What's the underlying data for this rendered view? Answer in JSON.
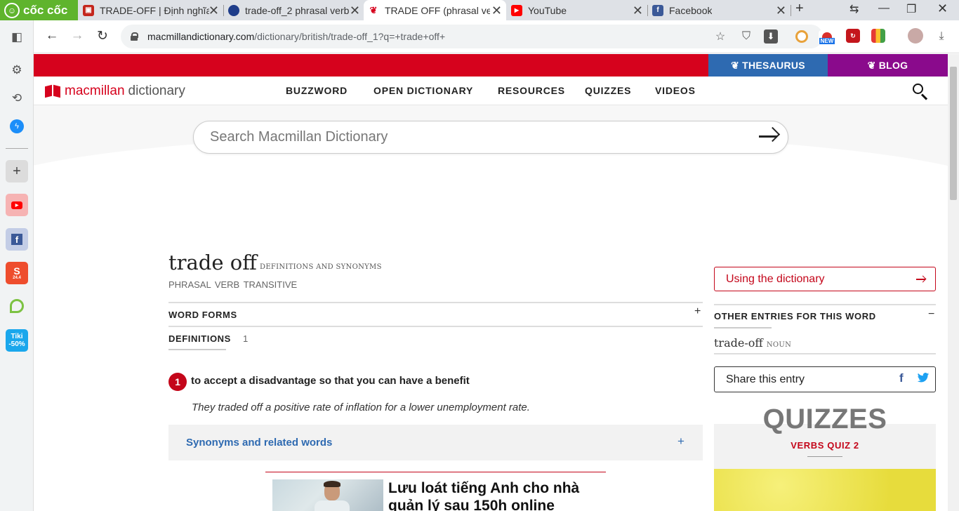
{
  "browser": {
    "brand": "cốc cốc",
    "tabs": [
      {
        "title": "TRADE-OFF | Định nghĩa",
        "favicon_color": "#c4261d"
      },
      {
        "title": "trade-off_2 phrasal verb",
        "favicon_color": "#1f3d8a"
      },
      {
        "title": "TRADE OFF (phrasal verb",
        "favicon_color": "#d6021d"
      },
      {
        "title": "YouTube",
        "favicon_color": "#ff0000"
      },
      {
        "title": "Facebook",
        "favicon_color": "#3b5998"
      }
    ],
    "url_host": "macmillandictionary.com",
    "url_path": "/dictionary/british/trade-off_1?q=+trade+off+",
    "ext_new_label": "NEW"
  },
  "sidebar": {
    "shopee_badge": "24.4",
    "tiki_label": "Tiki",
    "tiki_discount": "-50%"
  },
  "site": {
    "thesaurus_label": "THESAURUS",
    "blog_label": "BLOG",
    "logo_main": "macmillan",
    "logo_sub": "dictionary",
    "nav": [
      "BUZZWORD",
      "OPEN DICTIONARY",
      "RESOURCES",
      "QUIZZES",
      "VIDEOS"
    ],
    "search_placeholder": "Search Macmillan Dictionary"
  },
  "entry": {
    "headword": "trade off",
    "headword_sub": "DEFINITIONS AND SYNONYMS",
    "pos": "PHRASAL VERB  TRANSITIVE",
    "word_forms_label": "WORD FORMS",
    "definitions_label": "DEFINITIONS",
    "definitions_count": "1",
    "sense_number": "1",
    "definition": "to accept a disadvantage so that you can have a benefit",
    "example": "They traded off a positive rate of inflation for a lower unemployment rate.",
    "synonyms_label": "Synonyms and related words",
    "plus": "+",
    "minus": "−"
  },
  "ad": {
    "title": "Lưu loát tiếng Anh cho nhà quản lý sau 150h online"
  },
  "right": {
    "using_label": "Using the dictionary",
    "other_entries_label": "OTHER ENTRIES FOR THIS WORD",
    "other_entry_word": "trade-off",
    "other_entry_pos": "NOUN",
    "share_label": "Share this entry",
    "quizzes_label": "QUIZZES",
    "quiz_name": "VERBS QUIZ 2"
  },
  "colors": {
    "brand_red": "#d6021d",
    "thesaurus_blue": "#2e6ab1",
    "blog_purple": "#8a0a8c",
    "coccoc_green": "#5fb42d"
  }
}
